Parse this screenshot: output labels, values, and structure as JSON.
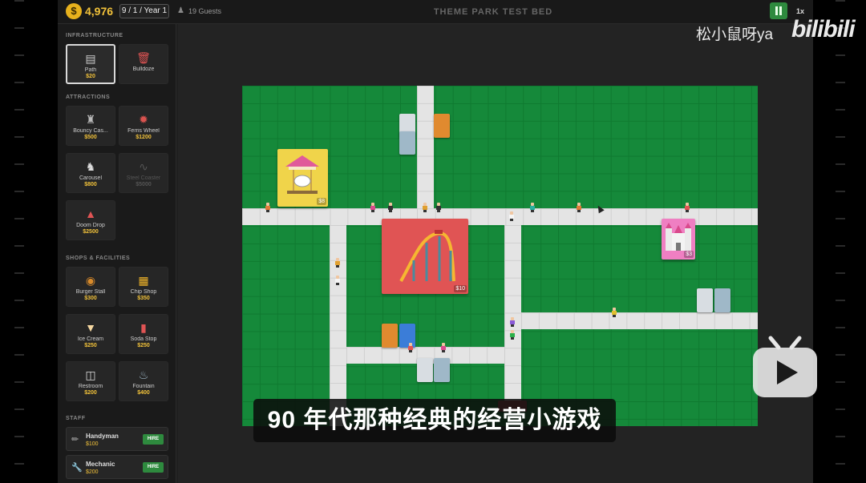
{
  "header": {
    "currency_icon": "$",
    "money": "4,976",
    "date": "9 / 1 / Year 1",
    "guests": "19 Guests",
    "title": "THEME PARK TEST BED",
    "speed": "1x"
  },
  "sidebar": {
    "infrastructure_label": "INFRASTRUCTURE",
    "infrastructure": [
      {
        "name": "Path",
        "price": "$20",
        "icon": "map-icon"
      },
      {
        "name": "Bulldoze",
        "price": "",
        "icon": "trash-icon"
      }
    ],
    "attractions_label": "ATTRACTIONS",
    "attractions": [
      {
        "name": "Bouncy Cas...",
        "price": "$500",
        "icon": "castle-icon"
      },
      {
        "name": "Ferris Wheel",
        "price": "$1200",
        "icon": "ferris-wheel-icon"
      },
      {
        "name": "Carousel",
        "price": "$800",
        "icon": "carousel-icon"
      },
      {
        "name": "Steel Coaster",
        "price": "$5000",
        "icon": "coaster-icon"
      },
      {
        "name": "Doom Drop",
        "price": "$2500",
        "icon": "drop-tower-icon"
      }
    ],
    "shops_label": "SHOPS & FACILITIES",
    "shops": [
      {
        "name": "Burger Stall",
        "price": "$300",
        "icon": "burger-icon"
      },
      {
        "name": "Chip Shop",
        "price": "$350",
        "icon": "fries-icon"
      },
      {
        "name": "Ice Cream",
        "price": "$250",
        "icon": "ice-cream-icon"
      },
      {
        "name": "Soda Stop",
        "price": "$250",
        "icon": "soda-icon"
      },
      {
        "name": "Restroom",
        "price": "$200",
        "icon": "toilet-icon"
      },
      {
        "name": "Fountain",
        "price": "$400",
        "icon": "fountain-icon"
      }
    ],
    "staff_label": "STAFF",
    "staff": [
      {
        "name": "Handyman",
        "price": "$100",
        "action": "HIRE",
        "icon": "broom-icon"
      },
      {
        "name": "Mechanic",
        "price": "$200",
        "action": "HIRE",
        "icon": "wrench-icon"
      }
    ]
  },
  "map": {
    "attractions": [
      {
        "name": "carousel",
        "price": "$8"
      },
      {
        "name": "steel-coaster",
        "price": "$10"
      },
      {
        "name": "bouncy-castle",
        "price": "$3"
      }
    ]
  },
  "overlay": {
    "subtitle": "90 年代那种经典的经营小游戏",
    "watermark_text": "松小鼠呀ya",
    "watermark_logo": "bilibili"
  },
  "colors": {
    "grass": "#15893a",
    "path": "#e4e4e4",
    "money": "#f2c23a",
    "hire": "#2e8a3e",
    "coaster": "#e05454",
    "carousel": "#f0d44a",
    "castle": "#ef7fc2"
  }
}
